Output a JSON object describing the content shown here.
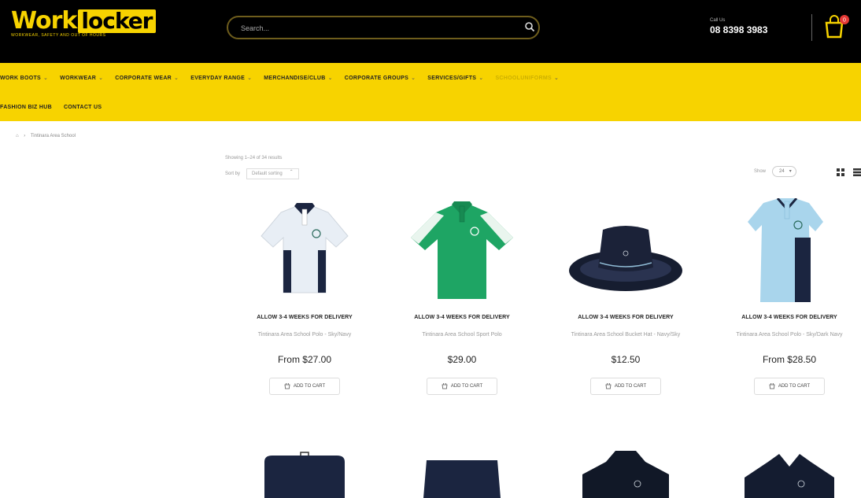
{
  "header": {
    "logo_part1": "Work",
    "logo_part2": "locker",
    "tagline": "WORKWEAR, SAFETY AND OUT OF HOURS",
    "search_placeholder": "Search...",
    "call_label": "Call Us",
    "phone": "08 8398 3983",
    "cart_count": "0",
    "colors": {
      "brand_yellow": "#f7d300",
      "bg": "#000000"
    }
  },
  "nav": {
    "row1": [
      {
        "label": "WORK BOOTS",
        "chevron": "⌄"
      },
      {
        "label": "WORKWEAR",
        "chevron": "⌄"
      },
      {
        "label": "CORPORATE WEAR",
        "chevron": "⌄"
      },
      {
        "label": "EVERYDAY RANGE",
        "chevron": "⌄"
      },
      {
        "label": "MERCHANDISE/CLUB",
        "chevron": "⌄"
      },
      {
        "label": "CORPORATE GROUPS",
        "chevron": "⌄"
      },
      {
        "label": "SERVICES/GIFTS",
        "chevron": "⌄"
      },
      {
        "label": "SCHOOLUNIFORMS",
        "chevron": "⌄",
        "faded": true
      }
    ],
    "row2": [
      {
        "label": "FASHION BIZ HUB"
      },
      {
        "label": "CONTACT US"
      }
    ]
  },
  "breadcrumb": [
    "⌂",
    "›",
    "Tintinara Area School"
  ],
  "toolbar": {
    "showing": "Showing 1–24 of 34 results",
    "sort_label": "Sort by",
    "sort_value": "Default sorting",
    "show_label": "Show",
    "show_value": "24"
  },
  "products": [
    {
      "badge": "ALLOW 3-4 WEEKS FOR DELIVERY",
      "name": "Tintinara Area School Polo - Sky/Navy",
      "price": "From $27.00",
      "button": "ADD TO CART",
      "image": "polo-shirt-white-navy"
    },
    {
      "badge": "ALLOW 3-4 WEEKS FOR DELIVERY",
      "name": "Tintinara Area School Sport Polo",
      "price": "$29.00",
      "button": "ADD TO CART",
      "image": "polo-shirt-green"
    },
    {
      "badge": "ALLOW 3-4 WEEKS FOR DELIVERY",
      "name": "Tintinara Area School Bucket Hat - Navy/Sky",
      "price": "$12.50",
      "button": "ADD TO CART",
      "image": "bucket-hat-navy"
    },
    {
      "badge": "ALLOW 3-4 WEEKS FOR DELIVERY",
      "name": "Tintinara Area School Polo - Sky/Dark Navy",
      "price": "From $28.50",
      "button": "ADD TO CART",
      "image": "polo-shirt-sky-navy"
    }
  ],
  "bottom_row_images": [
    "bag-navy",
    "shorts-navy",
    "jacket-navy",
    "rugby-top-navy"
  ]
}
